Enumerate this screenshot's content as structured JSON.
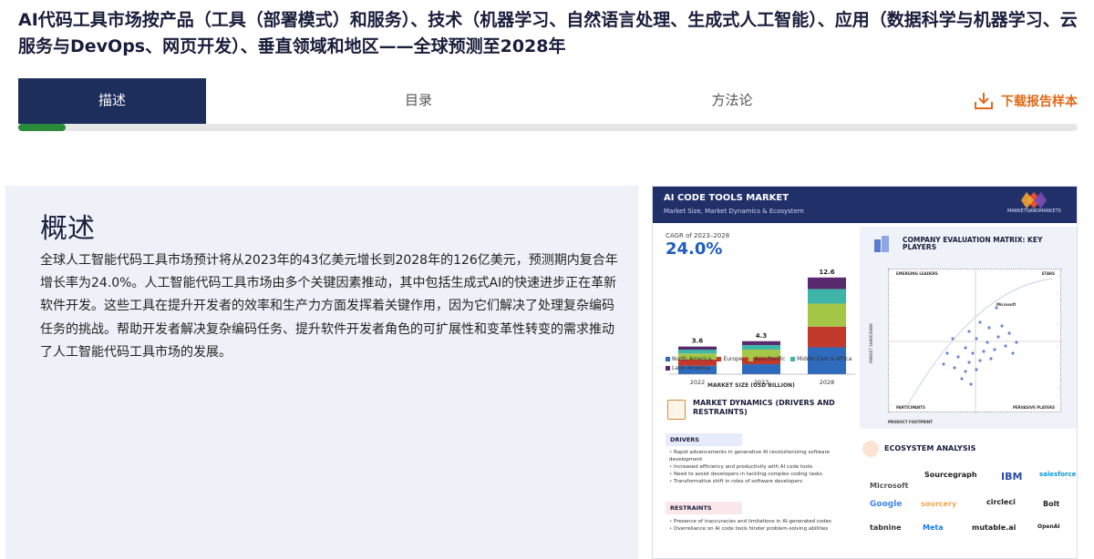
{
  "page": {
    "title": "AI代码工具市场按产品（工具（部署模式）和服务）、技术（机器学习、自然语言处理、生成式人工智能）、应用（数据科学与机器学习、云服务与DevOps、网页开发）、垂直领域和地区——全球预测至2028年"
  },
  "tabs": [
    {
      "label": "描述",
      "active": true
    },
    {
      "label": "目录",
      "active": false
    },
    {
      "label": "方法论",
      "active": false
    }
  ],
  "download": {
    "label": "下载报告样本"
  },
  "scroll_progress": 0.045,
  "overview": {
    "heading": "概述",
    "body": "全球人工智能代码工具市场预计将从2023年的43亿美元增长到2028年的126亿美元，预测期内复合年增长率为24.0%。人工智能代码工具市场由多个关键因素推动，其中包括生成式AI的快速进步正在革新软件开发。这些工具在提升开发者的效率和生产力方面发挥着关键作用，因为它们解决了处理复杂编码任务的挑战。帮助开发者解决复杂编码任务、提升软件开发者角色的可扩展性和变革性转变的需求推动了人工智能代码工具市场的发展。"
  },
  "infographic": {
    "title": "AI CODE TOOLS MARKET",
    "subtitle": "Market Size, Market Dynamics & Ecosystem",
    "logo_text": "MARKETSANDMARKETS",
    "cagr_label": "CAGR of 2023–2028",
    "cagr_value": "24.0%",
    "market_axis_title": "MARKET SIZE (USD BILLION)",
    "dynamics_title": "MARKET DYNAMICS (DRIVERS AND RESTRAINTS)",
    "drivers_label": "DRIVERS",
    "drivers": [
      "Rapid advancements in generative AI revolutionizing software development",
      "Increased efficiency and productivity with AI code tools",
      "Need to assist developers in tackling complex coding tasks",
      "Transformative shift in roles of software developers"
    ],
    "restraints_label": "RESTRAINTS",
    "restraints": [
      "Presence of inaccuracies and limitations in AI-generated codes",
      "Overreliance on AI code tools hinder problem-solving abilities"
    ],
    "matrix_title": "COMPANY EVALUATION MATRIX: KEY PLAYERS",
    "matrix_labels": {
      "emerging": "EMERGING LEADERS",
      "stars": "STARS",
      "participants": "PARTICIPANTS",
      "pervasive": "PERVASIVE PLAYERS",
      "x_axis": "PRODUCT FOOTPRINT",
      "y_axis": "MARKET SHARE/RANK",
      "highlight": "Microsoft"
    },
    "ecosystem_title": "ECOSYSTEM ANALYSIS",
    "ecosystem": [
      "Microsoft",
      "Sourcegraph",
      "IBM",
      "salesforce",
      "Google",
      "sourcery",
      "circleci",
      "Bolt",
      "tabnine",
      "Meta",
      "mutable.ai",
      "OpenAI"
    ]
  },
  "chart_data": {
    "type": "bar",
    "categories": [
      "2022",
      "2023",
      "2028"
    ],
    "totals": [
      3.6,
      4.3,
      12.6
    ],
    "series": [
      {
        "name": "North America",
        "color": "#2e6bbd",
        "values": [
          1.1,
          1.3,
          3.5
        ]
      },
      {
        "name": "Europe",
        "color": "#c0392b",
        "values": [
          0.8,
          0.9,
          2.7
        ]
      },
      {
        "name": "Asia Pacific",
        "color": "#a5c747",
        "values": [
          0.8,
          1.0,
          3.0
        ]
      },
      {
        "name": "Middle East & Africa",
        "color": "#3fb4a8",
        "values": [
          0.5,
          0.6,
          1.9
        ]
      },
      {
        "name": "Latin America",
        "color": "#5a2a6e",
        "values": [
          0.4,
          0.5,
          1.5
        ]
      }
    ],
    "xlabel": "",
    "ylabel": "",
    "ylim": [
      0,
      14
    ]
  },
  "colors": {
    "brand": "#1d2d5c",
    "accent": "#e06a1a",
    "progress": "#2a8a3a"
  }
}
